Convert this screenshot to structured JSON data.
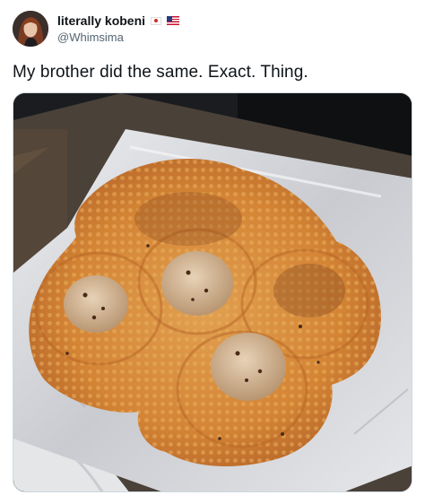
{
  "author": {
    "display_name": "literally kobeni",
    "handle": "@Whimsima",
    "badges": [
      "japan-flag-icon",
      "us-flag-icon"
    ]
  },
  "tweet": {
    "text": "My brother did the same. Exact. Thing."
  },
  "media": {
    "subject": "photo-baked-cookie-spread"
  },
  "colors": {
    "text_primary": "#0f1419",
    "text_secondary": "#536471",
    "cookie_orange": "#d98a3a",
    "foil": "#d9dade"
  }
}
